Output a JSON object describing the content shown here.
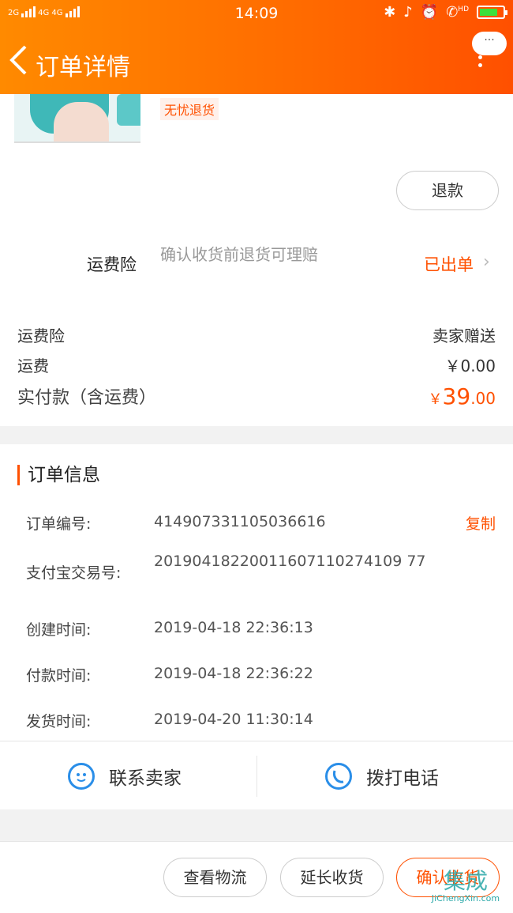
{
  "status_bar": {
    "signal_left": "2G",
    "signal_right": "4G 4G",
    "time": "14:09",
    "right_icons": [
      "bluetooth-icon",
      "bell-off-icon",
      "alarm-icon",
      "hd-call-icon"
    ],
    "hd_label": "HD"
  },
  "nav": {
    "back_icon": "chevron-left-icon",
    "title": "订单详情",
    "more_bubble": "···"
  },
  "product": {
    "tag": "无忧退货",
    "refund_button": "退款"
  },
  "insurance": {
    "label": "运费险",
    "description": "确认收货前退货可理赔",
    "status": "已出单",
    "chevron": "›"
  },
  "summary": {
    "rows": [
      {
        "label": "运费险",
        "value": "卖家赠送"
      },
      {
        "label": "运费",
        "value": "￥0.00"
      }
    ],
    "paid_label": "实付款（含运费）",
    "paid_currency": "￥",
    "paid_int": "39",
    "paid_dec": ".00"
  },
  "order_info": {
    "title": "订单信息",
    "rows": [
      {
        "label": "订单编号:",
        "value": "414907331105036616"
      },
      {
        "label": "支付宝交易号:",
        "value": "20190418220011607110274109 77"
      },
      {
        "label": "创建时间:",
        "value": "2019-04-18 22:36:13"
      },
      {
        "label": "付款时间:",
        "value": "2019-04-18 22:36:22"
      },
      {
        "label": "发货时间:",
        "value": "2019-04-20 11:30:14"
      }
    ],
    "copy_label": "复制"
  },
  "actions": {
    "contact_seller": "联系卖家",
    "call_phone": "拨打电话"
  },
  "bottom_bar": {
    "view_logistics": "查看物流",
    "extend_receipt": "延长收货",
    "confirm_receipt": "确认收货"
  },
  "watermark": {
    "glyphs": "集成",
    "text": "JiChengXin.com"
  },
  "colors": {
    "header_start": "#ff8a00",
    "header_end": "#ff5000",
    "accent": "#ff5000",
    "icon_blue": "#2a8ee8"
  }
}
